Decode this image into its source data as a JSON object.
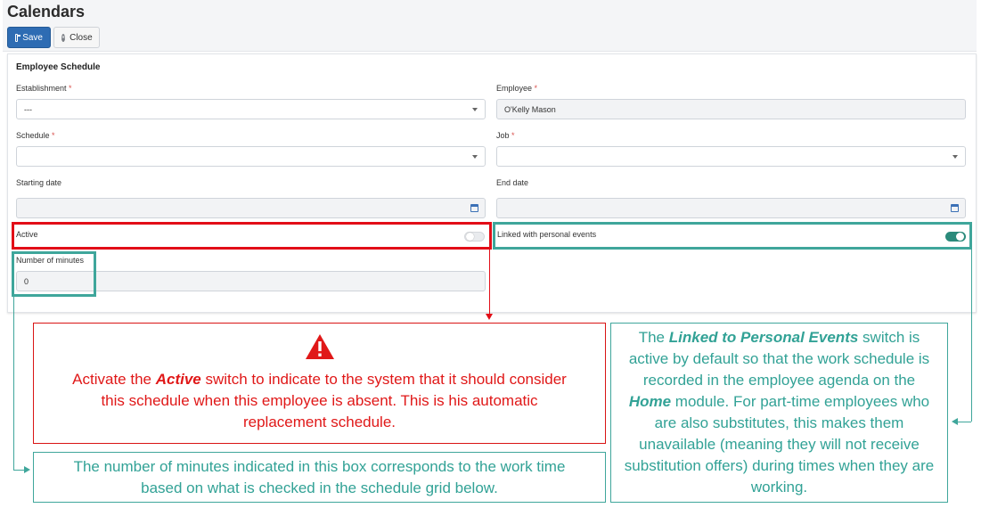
{
  "app": {
    "title": "Calendars"
  },
  "toolbar": {
    "save_label": "Save",
    "close_label": "Close"
  },
  "form": {
    "section_title": "Employee Schedule",
    "establishment": {
      "label": "Establishment",
      "required": "*",
      "value": "---"
    },
    "employee": {
      "label": "Employee",
      "required": "*",
      "value": "O'Kelly Mason"
    },
    "schedule": {
      "label": "Schedule",
      "required": "*",
      "value": ""
    },
    "job": {
      "label": "Job",
      "required": "*",
      "value": ""
    },
    "starting_date": {
      "label": "Starting date",
      "value": ""
    },
    "end_date": {
      "label": "End date",
      "value": ""
    },
    "active": {
      "label": "Active",
      "on": false
    },
    "linked": {
      "label": "Linked with personal events",
      "on": true
    },
    "minutes": {
      "label": "Number of minutes",
      "value": "0"
    }
  },
  "callouts": {
    "active": {
      "pre": "Activate the ",
      "emph": "Active",
      "post": " switch to indicate to the system that it should consider this schedule when this employee is absent. This is his automatic replacement schedule."
    },
    "minutes": {
      "text": "The number of minutes indicated in this box corresponds to the work time based on what is checked in the schedule grid below."
    },
    "linked": {
      "pre": "The ",
      "emph1": "Linked to Personal Events",
      "mid": " switch is active by default so that the work schedule is recorded in the employee agenda on the ",
      "emph2": "Home",
      "post": " module. For part-time employees who are also substitutes, this makes them unavailable (meaning they will not receive substitution offers) during times when they are working."
    }
  },
  "colors": {
    "accent": "#2e6cb3",
    "highlight_red": "#e20d17",
    "highlight_teal": "#3fa69b",
    "toggle_on": "#2b8a7b"
  },
  "icons": {
    "save": "save-icon",
    "close": "close-circle-icon",
    "warning": "warning-triangle-icon",
    "calendar": "calendar-icon",
    "dropdown": "chevron-down-icon"
  }
}
